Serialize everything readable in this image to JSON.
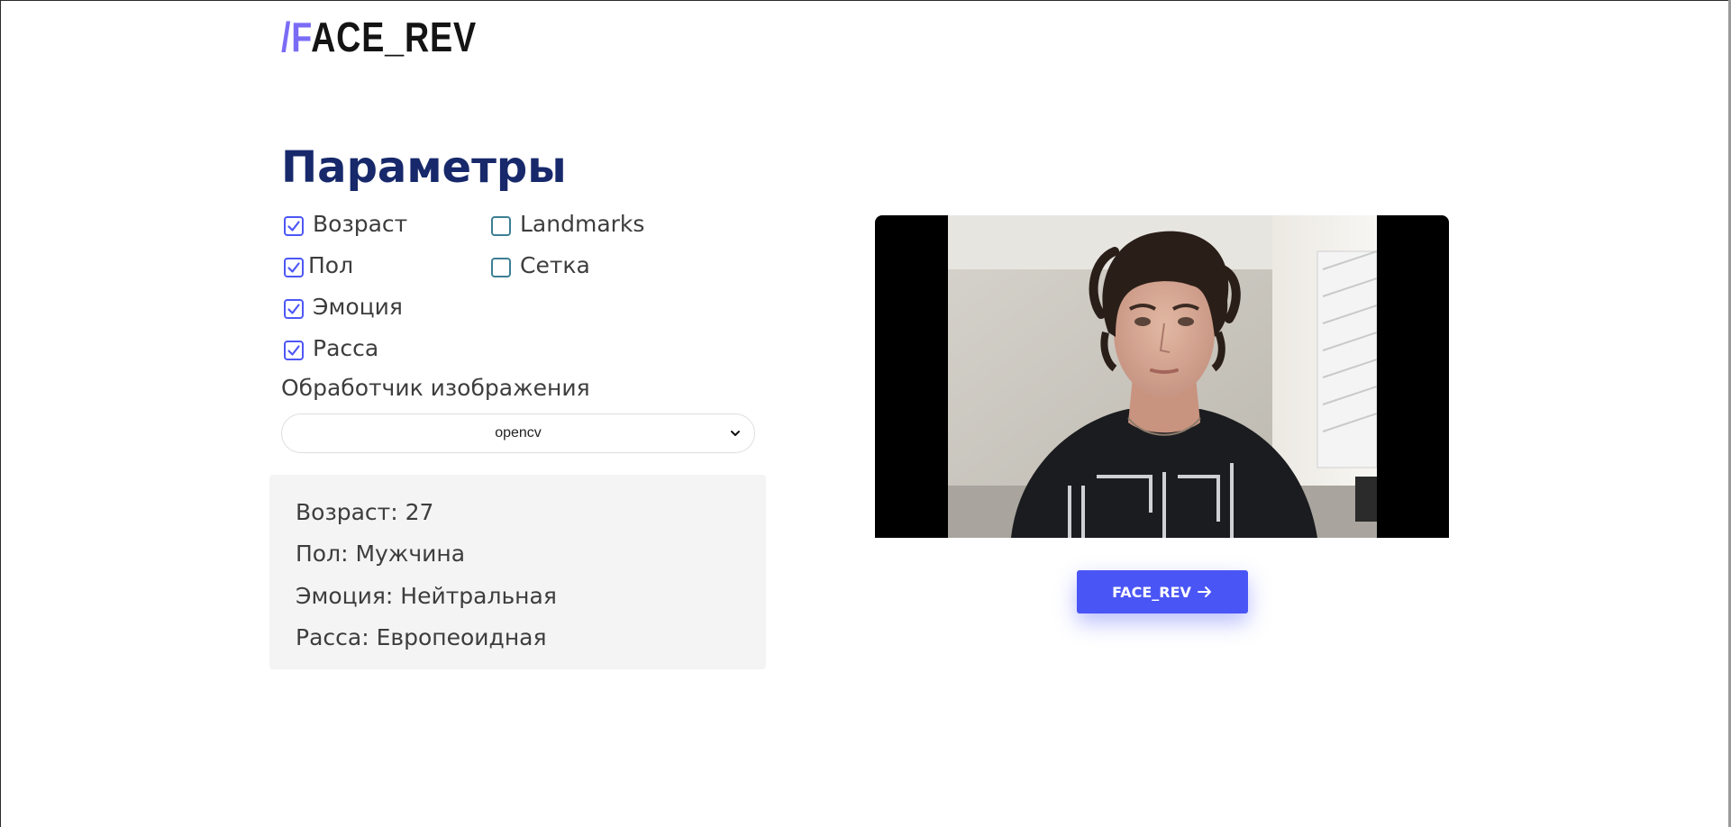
{
  "logo": {
    "slash_part": "/F",
    "rest": "ACE_REV"
  },
  "params": {
    "title": "Параметры",
    "options": [
      {
        "label": "Возраст",
        "checked": true
      },
      {
        "label": "Landmarks",
        "checked": false
      },
      {
        "label": "Пол",
        "checked": true
      },
      {
        "label": "Сетка",
        "checked": false
      },
      {
        "label": "Эмоция",
        "checked": true
      },
      {
        "label": "Расса",
        "checked": true
      }
    ],
    "processor_label": "Обработчик изображения",
    "processor_value": "opencv"
  },
  "results": {
    "age": "Возраст: 27",
    "gender": "Пол: Мужчина",
    "emotion": "Эмоция: Нейтральная",
    "race": "Расса: Европеоидная"
  },
  "action_button": {
    "label": "FACE_REV"
  },
  "colors": {
    "accent": "#4a55f5",
    "logo_accent": "#7b6cf6",
    "title": "#17296b",
    "panel_bg": "#f4f4f4"
  }
}
